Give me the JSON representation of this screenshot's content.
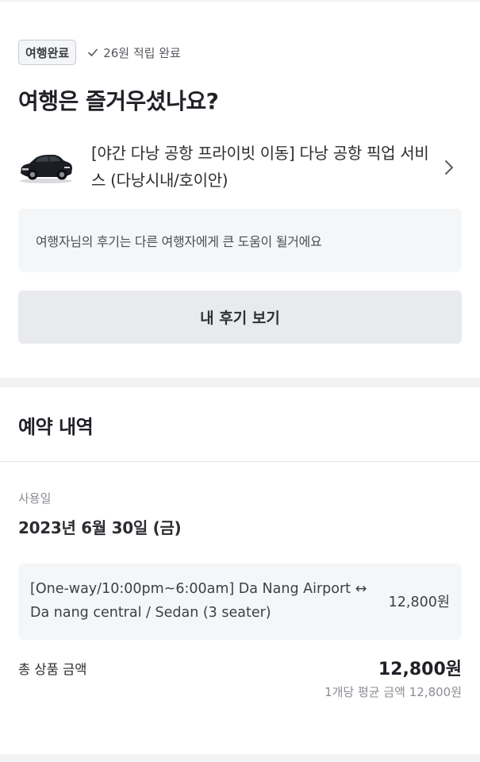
{
  "status": {
    "badge": "여행완료",
    "reward": "26원 적립 완료",
    "check_icon": "check-icon"
  },
  "heading": "여행은 즐거우셨나요?",
  "product": {
    "name": "[야간 다낭 공항 프라이빗 이동] 다낭 공항 픽업 서비스 (다낭시내/호이안)",
    "image": "black-sedan-car",
    "arrow_icon": "chevron-right-icon"
  },
  "review_hint": "여행자님의 후기는 다른 여행자에게 큰 도움이 될거에요",
  "review_button": "내 후기 보기",
  "reservation": {
    "title": "예약 내역",
    "usage_label": "사용일",
    "usage_date": "2023년 6월 30일 (금)",
    "item": {
      "description": "[One-way/10:00pm~6:00am] Da Nang Airport ↔ Da nang central / Sedan (3 seater)",
      "price": "12,800원"
    },
    "total_label": "총 상품 금액",
    "total_price": "12,800원",
    "average": "1개당 평균 금액 12,800원"
  },
  "colors": {
    "background": "#f2f3f5",
    "card": "#ffffff",
    "button": "#e9eaed"
  }
}
